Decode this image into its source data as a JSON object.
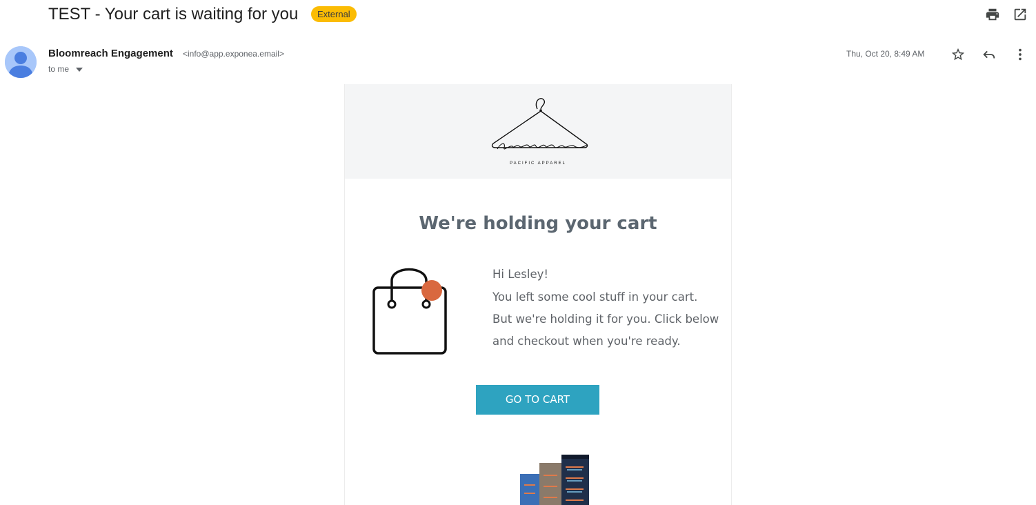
{
  "email": {
    "subject": "TEST - Your cart is waiting for you",
    "badge": "External",
    "sender_name": "Bloomreach Engagement",
    "sender_email": "<info@app.exponea.email>",
    "recipient": "to me",
    "date": "Thu, Oct 20, 8:49 AM"
  },
  "icons": {
    "print": "print-icon",
    "open_new_window": "open-in-new-window-icon",
    "star": "star-icon",
    "reply": "reply-icon",
    "more": "more-vert-icon",
    "recipient_dropdown": "caret-down-icon",
    "avatar": "default-person-avatar"
  },
  "body": {
    "logo_text": "pacific",
    "logo_caption": "PACIFIC APPAREL",
    "headline": "We're holding your cart",
    "message_lines": [
      "Hi Lesley!",
      "You left some cool stuff in your cart.",
      "But we're holding it for you. Click below",
      "and checkout when you're ready."
    ],
    "cta_label": "GO TO CART"
  },
  "colors": {
    "badge": "#fbbc04",
    "cta": "#2ea3c0",
    "headline": "#5b6670",
    "header_band": "#f4f5f6",
    "bag_dot": "#d9683f",
    "avatar": "#a8c7fa"
  }
}
